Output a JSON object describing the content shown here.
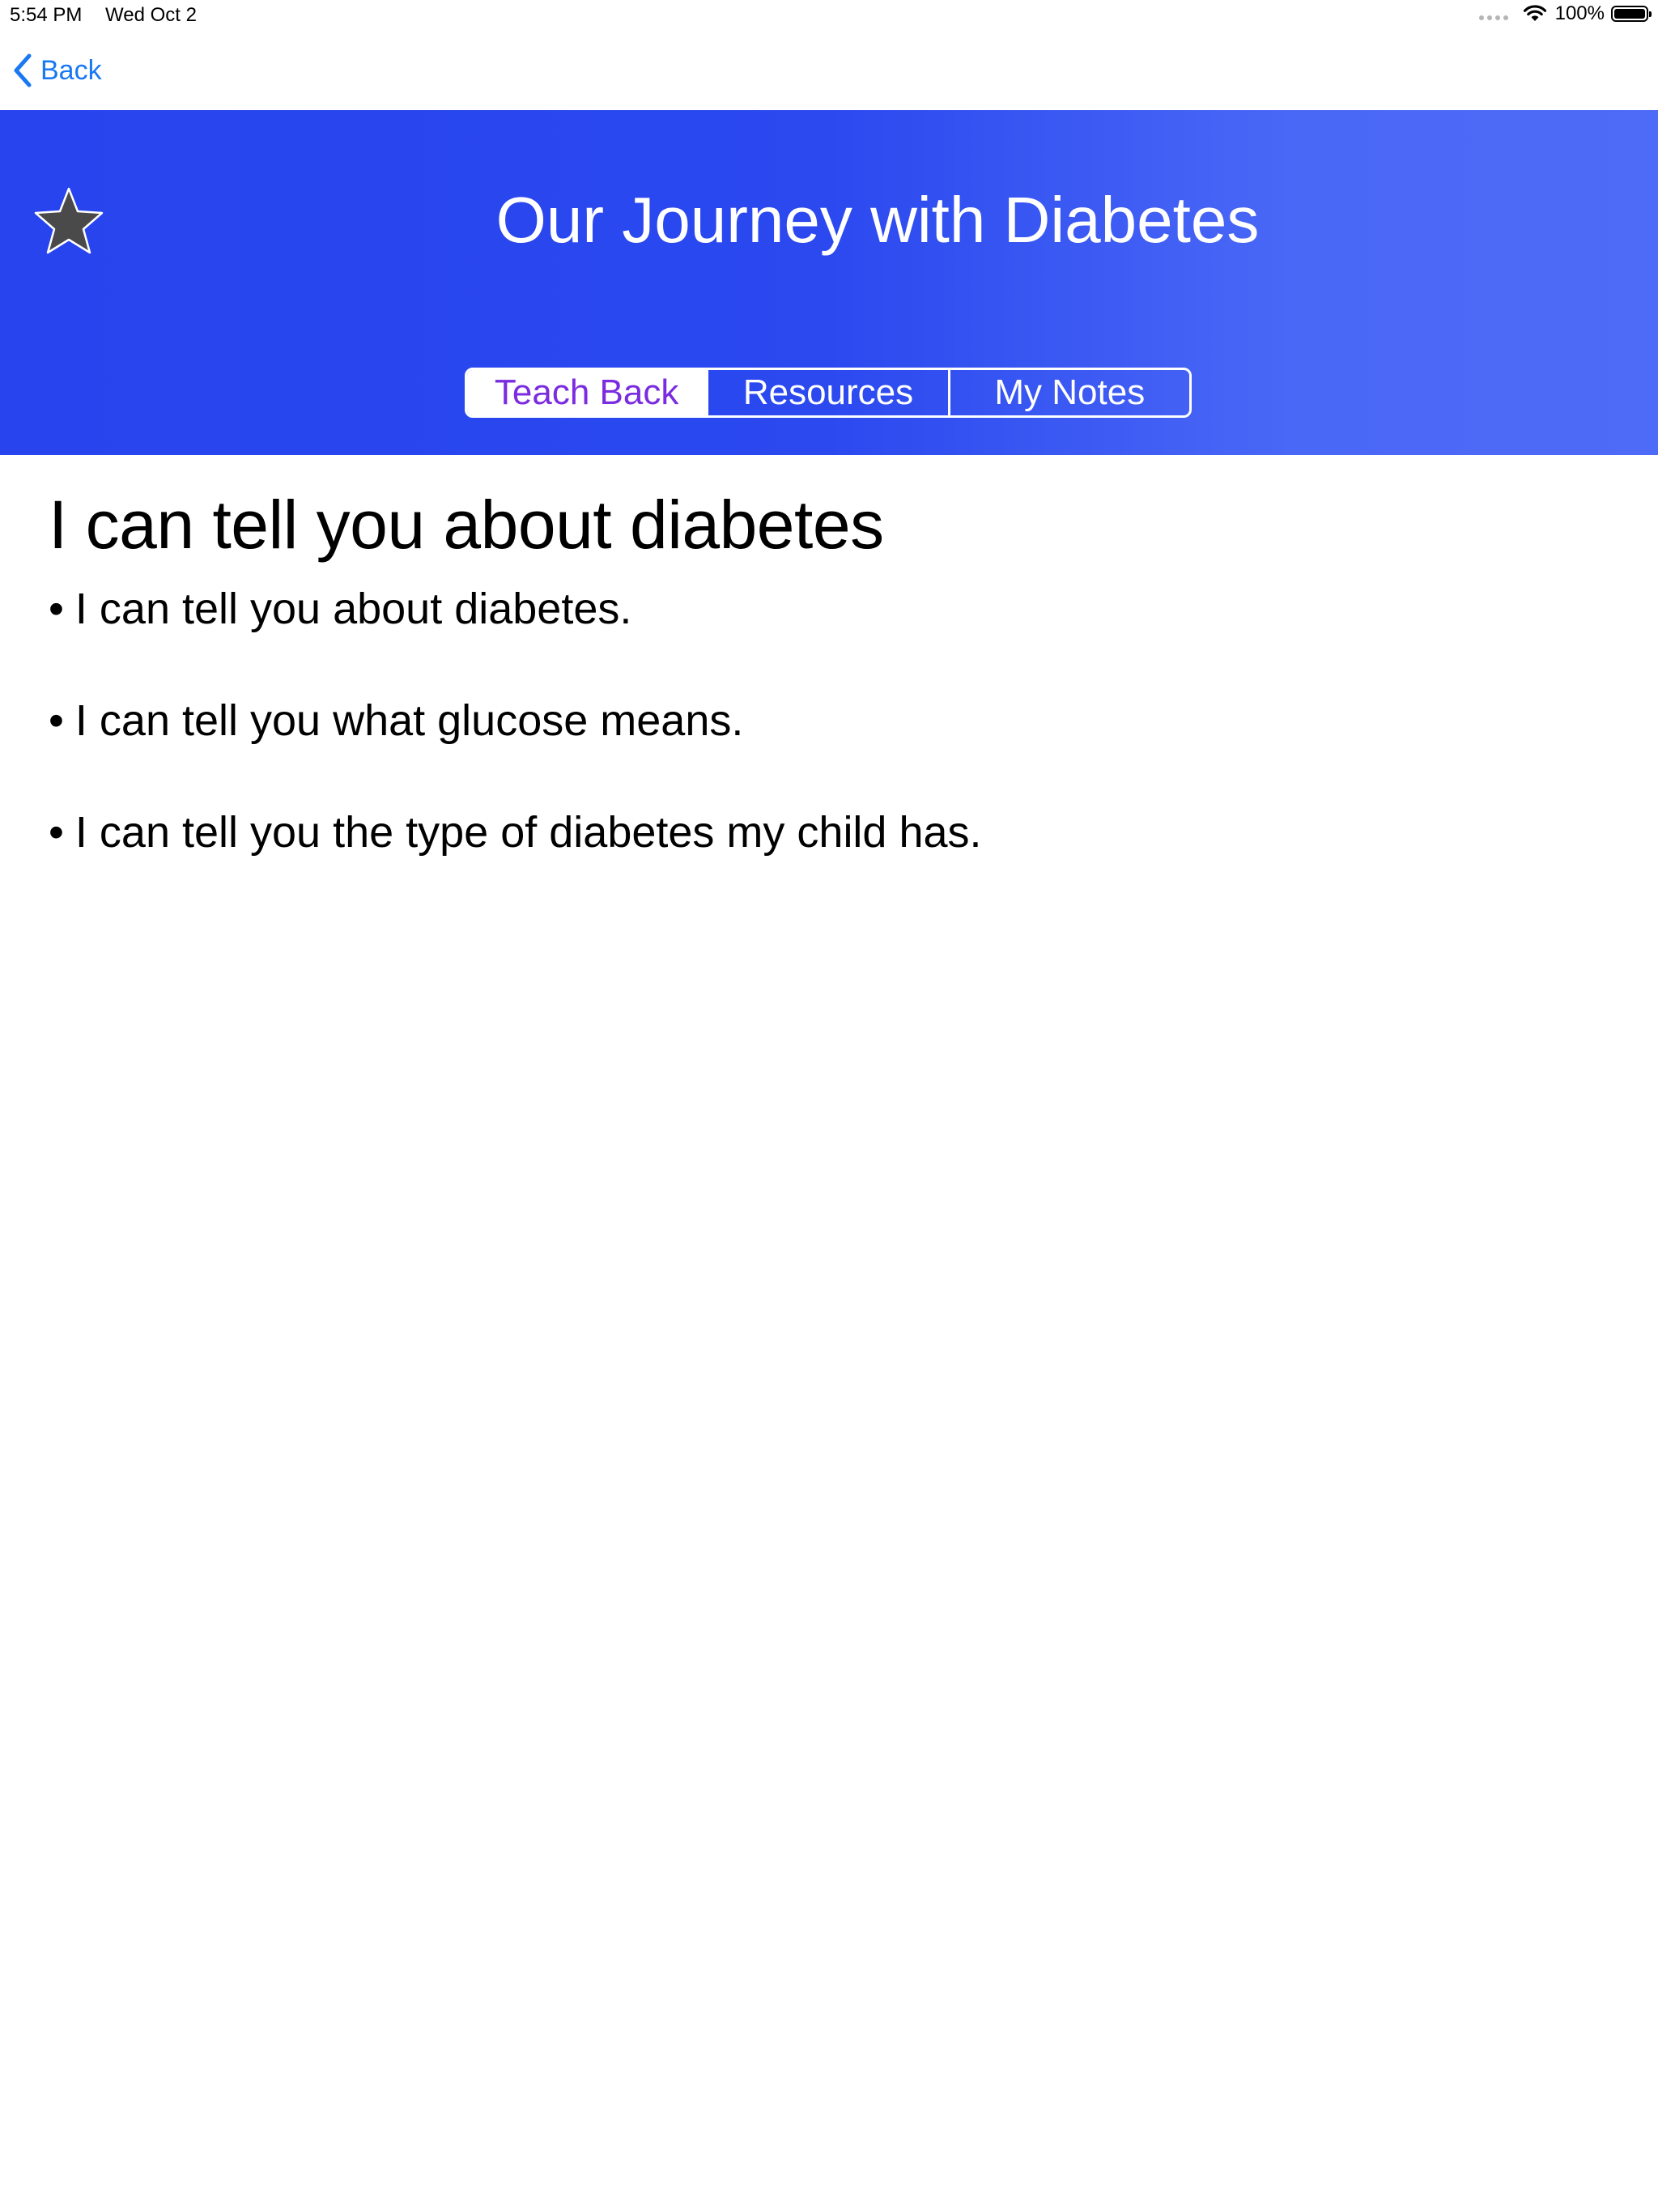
{
  "status_bar": {
    "time": "5:54 PM",
    "date": "Wed Oct 2",
    "battery_percent": "100%"
  },
  "nav": {
    "back_label": "Back"
  },
  "banner": {
    "title": "Our Journey with Diabetes",
    "star_icon": "star-icon",
    "tabs": [
      {
        "label": "Teach Back",
        "active": true
      },
      {
        "label": "Resources",
        "active": false
      },
      {
        "label": "My Notes",
        "active": false
      }
    ]
  },
  "content": {
    "heading": "I can tell you about diabetes",
    "bullet_char": "•",
    "items": [
      "I can tell you about diabetes.",
      "I can tell you what glucose means.",
      "I can tell you the type of diabetes my child has."
    ]
  },
  "colors": {
    "accent_blue": "#1a78f2",
    "banner_start": "#2744ee",
    "banner_end": "#4d6bf6",
    "active_tab_text": "#7b2be0"
  }
}
